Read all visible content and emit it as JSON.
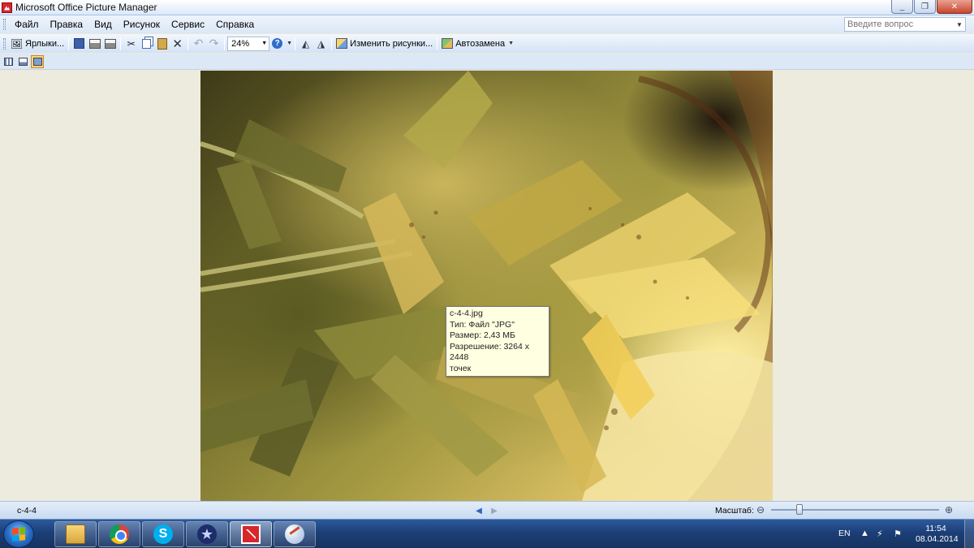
{
  "window": {
    "title": "Microsoft Office Picture Manager",
    "controls": {
      "minimize": "_",
      "restore": "❐",
      "close": "✕"
    }
  },
  "menubar": {
    "items": [
      {
        "label": "Файл",
        "underline": "Ф"
      },
      {
        "label": "Правка"
      },
      {
        "label": "Вид"
      },
      {
        "label": "Рисунок"
      },
      {
        "label": "Сервис"
      },
      {
        "label": "Справка"
      }
    ],
    "help_search": {
      "placeholder": "Введите вопрос"
    }
  },
  "toolbar": {
    "shortcuts_label": "Ярлыки...",
    "zoom_value": "24%",
    "edit_pictures_label": "Изменить рисунки...",
    "autocorrect_label": "Автозамена",
    "icons": [
      "shortcuts-icon",
      "save-icon",
      "print-icon",
      "email-icon",
      "cut-icon",
      "copy-icon",
      "paste-icon",
      "delete-icon",
      "undo-icon",
      "redo-icon",
      "help-icon",
      "rotate-left-icon",
      "rotate-right-icon",
      "edit-pictures-icon",
      "autocorrect-icon"
    ]
  },
  "viewbar": {
    "modes": [
      "thumbnail-view",
      "filmstrip-view",
      "single-picture-view"
    ],
    "active": "single-picture-view"
  },
  "tooltip": {
    "filename": "c-4-4.jpg",
    "type": "Тип: Файл \"JPG\"",
    "size": "Размер: 2,43 МБ",
    "resolution": "Разрешение: 3264 x 2448",
    "resolution_unit": "точек"
  },
  "statusbar": {
    "filename": "c-4-4",
    "zoom_label": "Масштаб:",
    "zoom_level": 0.17
  },
  "taskbar": {
    "apps": [
      {
        "name": "explorer",
        "active": false
      },
      {
        "name": "chrome",
        "active": false
      },
      {
        "name": "skype",
        "active": false
      },
      {
        "name": "star-app",
        "active": false
      },
      {
        "name": "picture-manager",
        "active": true
      },
      {
        "name": "paint",
        "active": false
      }
    ],
    "language": "EN",
    "time": "11:54",
    "date": "08.04.2014"
  },
  "colors": {
    "title_gradient_top": "#ffffff",
    "menu_bg": "#dbe7f7",
    "workspace_bg": "#ecebdd",
    "tooltip_bg": "#ffffe1",
    "taskbar_bg": "#1c3f78"
  }
}
